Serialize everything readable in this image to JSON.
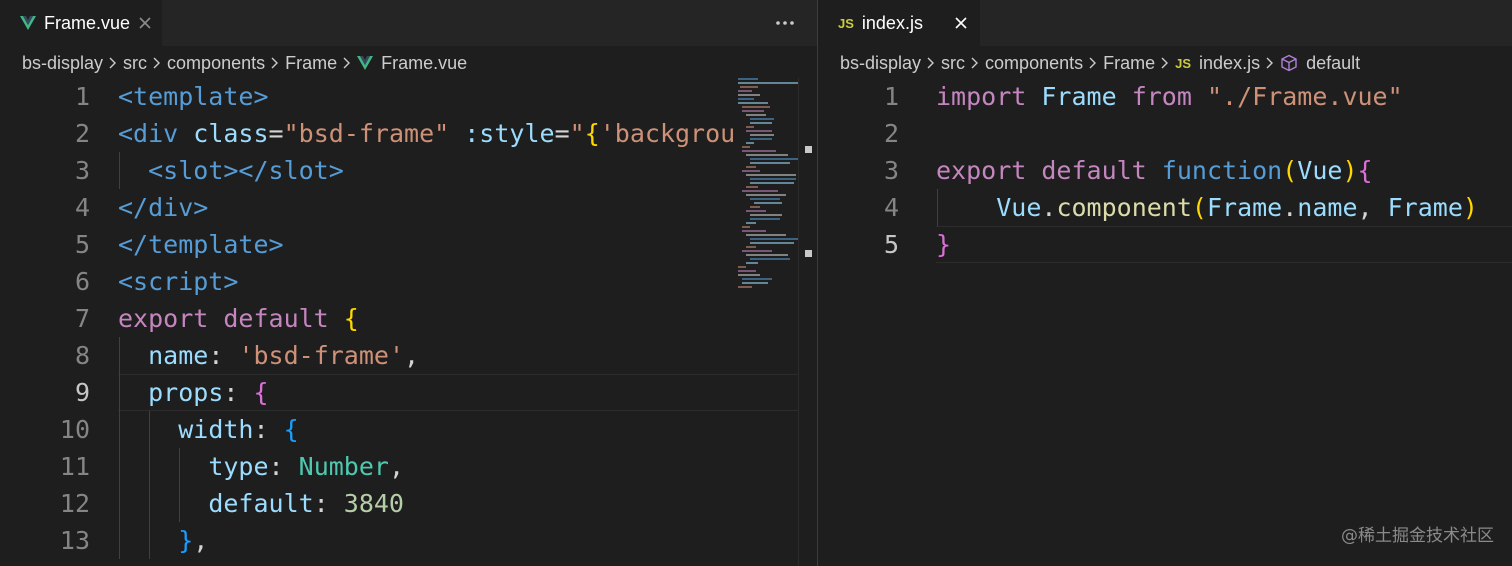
{
  "colors": {
    "editor_bg": "#1e1e1e",
    "tabbar_bg": "#252526",
    "vue_icon": "#41b883",
    "js_icon": "#cbcb41",
    "keyword": "#c586c0",
    "tag": "#569cd6",
    "string": "#ce9178",
    "number": "#b5cea8",
    "type": "#4ec9b0",
    "function": "#dcdcaa",
    "variable": "#9cdcfe"
  },
  "left": {
    "tab": {
      "label": "Frame.vue",
      "icon": "vue-icon",
      "close_icon": "close-icon"
    },
    "more_actions_icon": "more-actions-icon",
    "breadcrumb": [
      "bs-display",
      "src",
      "components",
      "Frame",
      "Frame.vue"
    ],
    "active_line": 9,
    "lines": [
      {
        "num": "1",
        "tokens": [
          [
            "tag",
            "<template>"
          ]
        ]
      },
      {
        "num": "2",
        "tokens": [
          [
            "tag",
            "<div"
          ],
          [
            "plain",
            " "
          ],
          [
            "attr",
            "class"
          ],
          [
            "plain",
            "="
          ],
          [
            "str",
            "\"bsd-frame\""
          ],
          [
            "plain",
            " "
          ],
          [
            "attr",
            ":style"
          ],
          [
            "plain",
            "="
          ],
          [
            "str",
            "\""
          ],
          [
            "bracket",
            "{"
          ],
          [
            "str",
            "'backgrou"
          ]
        ]
      },
      {
        "num": "3",
        "tokens": [
          [
            "plain",
            "  "
          ],
          [
            "tag",
            "<slot></slot>"
          ]
        ]
      },
      {
        "num": "4",
        "tokens": [
          [
            "tag",
            "</div>"
          ]
        ]
      },
      {
        "num": "5",
        "tokens": [
          [
            "tag",
            "</template>"
          ]
        ]
      },
      {
        "num": "6",
        "tokens": [
          [
            "tag",
            "<script>"
          ]
        ]
      },
      {
        "num": "7",
        "tokens": [
          [
            "kw",
            "export"
          ],
          [
            "plain",
            " "
          ],
          [
            "kw",
            "default"
          ],
          [
            "plain",
            " "
          ],
          [
            "bracket",
            "{"
          ]
        ]
      },
      {
        "num": "8",
        "tokens": [
          [
            "plain",
            "  "
          ],
          [
            "ident",
            "name"
          ],
          [
            "plain",
            ": "
          ],
          [
            "str",
            "'bsd-frame'"
          ],
          [
            "plain",
            ","
          ]
        ]
      },
      {
        "num": "9",
        "tokens": [
          [
            "plain",
            "  "
          ],
          [
            "ident",
            "props"
          ],
          [
            "plain",
            ": "
          ],
          [
            "p2",
            "{"
          ]
        ]
      },
      {
        "num": "10",
        "tokens": [
          [
            "plain",
            "    "
          ],
          [
            "ident",
            "width"
          ],
          [
            "plain",
            ": "
          ],
          [
            "p3",
            "{"
          ]
        ]
      },
      {
        "num": "11",
        "tokens": [
          [
            "plain",
            "      "
          ],
          [
            "ident",
            "type"
          ],
          [
            "plain",
            ": "
          ],
          [
            "type",
            "Number"
          ],
          [
            "plain",
            ","
          ]
        ]
      },
      {
        "num": "12",
        "tokens": [
          [
            "plain",
            "      "
          ],
          [
            "ident",
            "default"
          ],
          [
            "plain",
            ": "
          ],
          [
            "num",
            "3840"
          ]
        ]
      },
      {
        "num": "13",
        "tokens": [
          [
            "plain",
            "    "
          ],
          [
            "p3",
            "}"
          ],
          [
            "plain",
            ","
          ]
        ]
      }
    ]
  },
  "right": {
    "tab": {
      "label": "index.js",
      "icon": "js-icon",
      "close_icon": "close-icon"
    },
    "breadcrumb": [
      "bs-display",
      "src",
      "components",
      "Frame",
      "index.js",
      "default"
    ],
    "active_line": 5,
    "lines": [
      {
        "num": "1",
        "tokens": [
          [
            "kw",
            "import"
          ],
          [
            "plain",
            " "
          ],
          [
            "ident",
            "Frame"
          ],
          [
            "plain",
            " "
          ],
          [
            "kw",
            "from"
          ],
          [
            "plain",
            " "
          ],
          [
            "str",
            "\"./Frame.vue\""
          ]
        ]
      },
      {
        "num": "2",
        "tokens": []
      },
      {
        "num": "3",
        "tokens": [
          [
            "kw",
            "export"
          ],
          [
            "plain",
            " "
          ],
          [
            "kw",
            "default"
          ],
          [
            "plain",
            " "
          ],
          [
            "tag",
            "function"
          ],
          [
            "bracket",
            "("
          ],
          [
            "ident",
            "Vue"
          ],
          [
            "bracket",
            ")"
          ],
          [
            "p2",
            "{"
          ]
        ]
      },
      {
        "num": "4",
        "tokens": [
          [
            "plain",
            "    "
          ],
          [
            "ident",
            "Vue"
          ],
          [
            "plain",
            "."
          ],
          [
            "fn",
            "component"
          ],
          [
            "bracket",
            "("
          ],
          [
            "ident",
            "Frame"
          ],
          [
            "plain",
            "."
          ],
          [
            "ident",
            "name"
          ],
          [
            "plain",
            ", "
          ],
          [
            "ident",
            "Frame"
          ],
          [
            "bracket",
            ")"
          ]
        ]
      },
      {
        "num": "5",
        "tokens": [
          [
            "p2",
            "}"
          ]
        ]
      }
    ]
  },
  "watermark": "@稀土掘金技术社区"
}
